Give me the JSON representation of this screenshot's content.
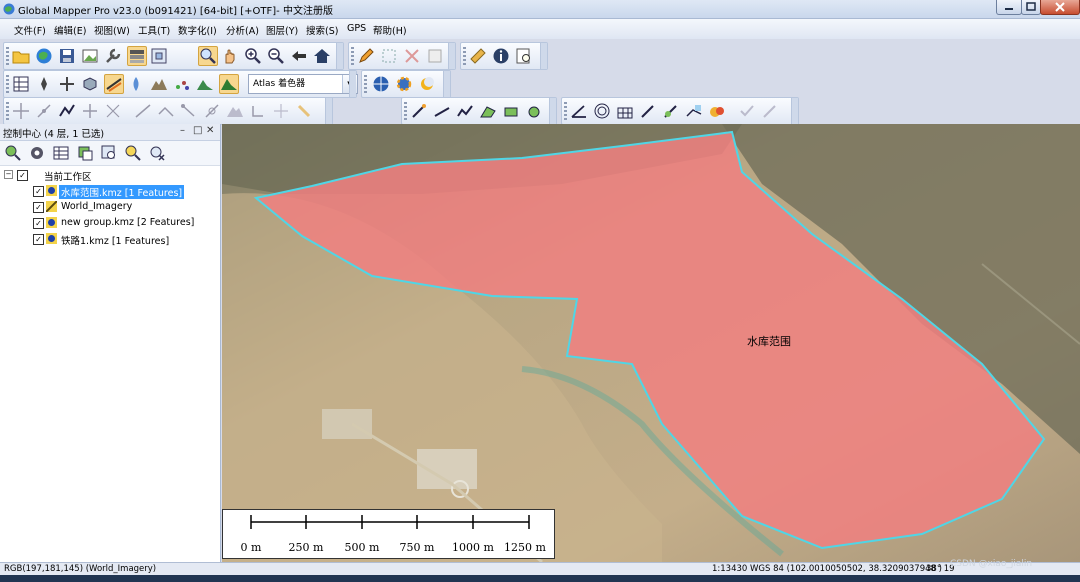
{
  "window": {
    "title": "Global Mapper Pro v23.0 (b091421) [64-bit] [+OTF]- 中文注册版"
  },
  "menu": [
    {
      "label": "文件(F)"
    },
    {
      "label": "编辑(E)"
    },
    {
      "label": "视图(W)"
    },
    {
      "label": "工具(T)"
    },
    {
      "label": "数字化(I)"
    },
    {
      "label": "分析(A)"
    },
    {
      "label": "图层(Y)"
    },
    {
      "label": "搜索(S)"
    },
    {
      "label": "GPS"
    },
    {
      "label": "帮助(H)"
    }
  ],
  "toolbar": {
    "atlas_label": "Atlas",
    "shading_value": "着色器"
  },
  "panel": {
    "title": "控制中心 (4 层, 1 已选)",
    "tree": {
      "root": "当前工作区",
      "layers": [
        {
          "label": "水库范围.kmz [1 Features]",
          "selected": true
        },
        {
          "label": "World_Imagery",
          "selected": false
        },
        {
          "label": "new group.kmz [2 Features]",
          "selected": false
        },
        {
          "label": "铁路1.kmz [1 Features]",
          "selected": false
        }
      ]
    }
  },
  "map": {
    "feature_label": "水库范围",
    "feature_fill": "#f08080",
    "feature_outline": "#4fd6e6",
    "scale_labels": [
      "0 m",
      "250 m",
      "500 m",
      "750 m",
      "1000 m",
      "1250 m"
    ]
  },
  "status": {
    "pixel_info": "RGB(197,181,145) (World_Imagery)",
    "scale": "1:13430",
    "coords": "WGS 84 (102.0010050502, 38.3209037948 )",
    "dms": "38° 19"
  },
  "watermark": "CSDN @xiao_jialin",
  "colors": {
    "titlebar": "#c9d7ec",
    "selection": "#3399ff"
  }
}
